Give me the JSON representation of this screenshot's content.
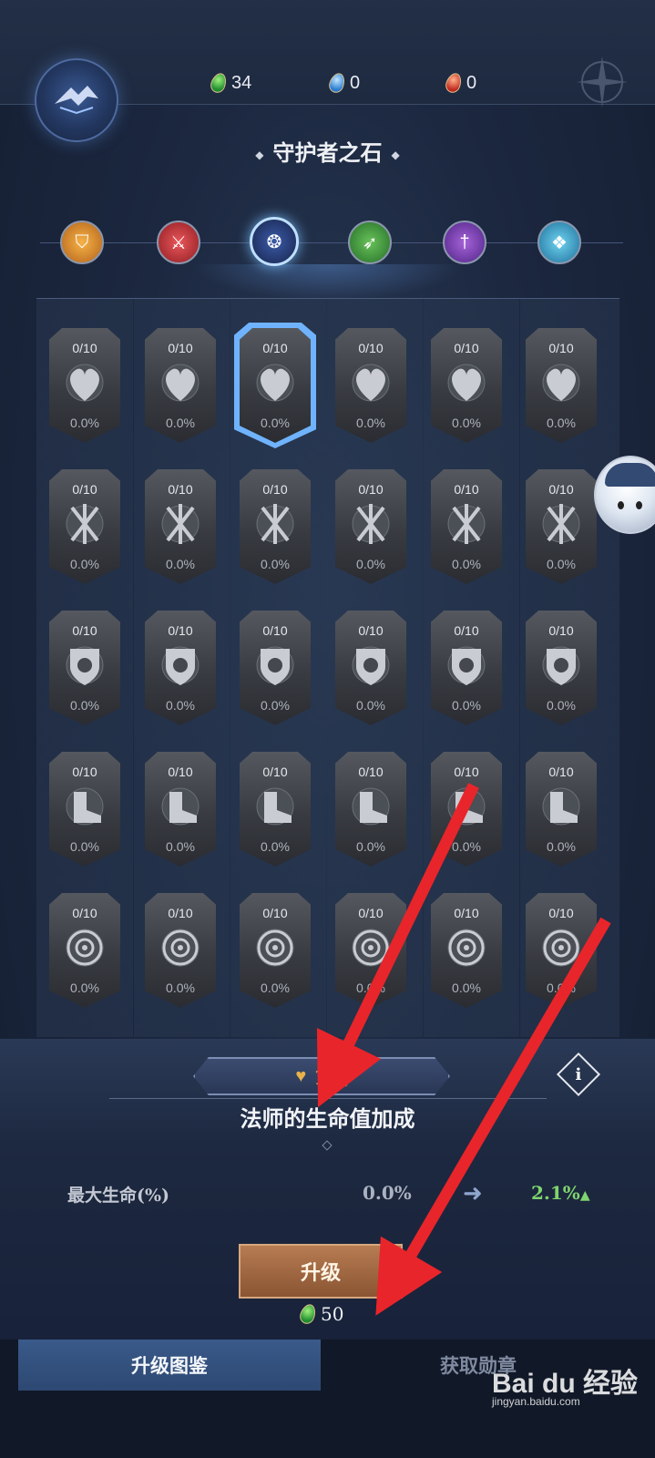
{
  "currencies": [
    {
      "name": "green-gem",
      "value": "34"
    },
    {
      "name": "blue-gem",
      "value": "0"
    },
    {
      "name": "red-gem",
      "value": "0"
    }
  ],
  "title": "守护者之石",
  "class_tabs": [
    {
      "name": "class-tab-guardian",
      "icon": "shield-icon",
      "active": false
    },
    {
      "name": "class-tab-warrior",
      "icon": "axe-icon",
      "active": false
    },
    {
      "name": "class-tab-mage",
      "icon": "swirl-icon",
      "active": true
    },
    {
      "name": "class-tab-archer",
      "icon": "bow-icon",
      "active": false
    },
    {
      "name": "class-tab-assassin",
      "icon": "dagger-icon",
      "active": false
    },
    {
      "name": "class-tab-support",
      "icon": "wings-icon",
      "active": false
    }
  ],
  "medal_rows": [
    {
      "icon": "heart-icon",
      "count": "0/10",
      "pct": "0.0%"
    },
    {
      "icon": "crossed-swords-icon",
      "count": "0/10",
      "pct": "0.0%"
    },
    {
      "icon": "swirl-shield-icon",
      "count": "0/10",
      "pct": "0.0%"
    },
    {
      "icon": "boot-icon",
      "count": "0/10",
      "pct": "0.0%"
    },
    {
      "icon": "target-icon",
      "count": "0/10",
      "pct": "0.0%"
    }
  ],
  "grid": {
    "rows": 5,
    "cols": 6,
    "selected_row": 0,
    "selected_col": 2
  },
  "detail": {
    "level": "1级",
    "skill_name": "法师的生命值加成",
    "stat_label": "最大生命(%)",
    "stat_current": "0.0%",
    "stat_next": "2.1%"
  },
  "upgrade": {
    "label": "升级",
    "cost": "50"
  },
  "bottom_tabs": [
    {
      "label": "升级图鉴",
      "active": true
    },
    {
      "label": "获取勋章",
      "active": false
    }
  ],
  "watermark": {
    "logo": "Bai du 经验",
    "url": "jingyan.baidu.com"
  },
  "colors": {
    "accent_blue": "#6fb3ff",
    "upgrade_bg": "#a06a43",
    "stat_up": "#7fd46e",
    "annotation_red": "#e8252a"
  }
}
